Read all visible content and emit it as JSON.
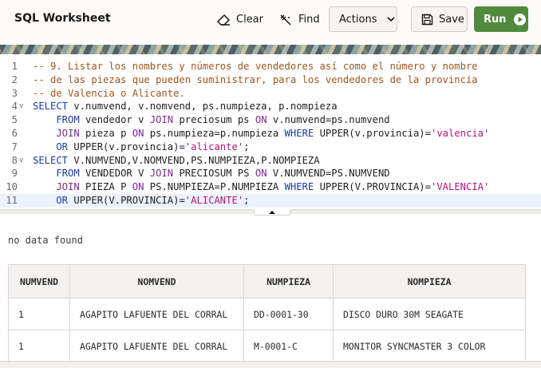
{
  "header": {
    "title": "SQL Worksheet",
    "clear_label": "Clear",
    "find_label": "Find",
    "actions_label": "Actions",
    "save_label": "Save",
    "run_label": "Run",
    "run_color": "#508a3c"
  },
  "editor": {
    "lines": [
      {
        "n": "1",
        "fold": "",
        "tokens": [
          {
            "t": "-- 9. Listar los nombres y números de vendedores así como el número y nombre",
            "c": "com"
          }
        ]
      },
      {
        "n": "2",
        "fold": "",
        "tokens": [
          {
            "t": "-- de las piezas que pueden suministrar, para los vendedores de la provincia",
            "c": "com"
          }
        ]
      },
      {
        "n": "3",
        "fold": "",
        "tokens": [
          {
            "t": "-- de Valencia o Alicante.",
            "c": "com"
          }
        ]
      },
      {
        "n": "4",
        "fold": "v",
        "tokens": [
          {
            "t": "SELECT",
            "c": "kw"
          },
          {
            "t": " v.numvend, v.nomvend, ps.numpieza, p.nompieza",
            "c": ""
          }
        ]
      },
      {
        "n": "5",
        "fold": "",
        "tokens": [
          {
            "t": "    FROM",
            "c": "kw"
          },
          {
            "t": " vendedor v ",
            "c": ""
          },
          {
            "t": "JOIN",
            "c": "kw2"
          },
          {
            "t": " preciosum ps ",
            "c": ""
          },
          {
            "t": "ON",
            "c": "kw2"
          },
          {
            "t": " v.numvend=ps.numvend",
            "c": ""
          }
        ]
      },
      {
        "n": "6",
        "fold": "",
        "tokens": [
          {
            "t": "    JOIN",
            "c": "kw2"
          },
          {
            "t": " pieza p ",
            "c": ""
          },
          {
            "t": "ON",
            "c": "kw2"
          },
          {
            "t": " ps.numpieza=p.numpieza ",
            "c": ""
          },
          {
            "t": "WHERE",
            "c": "kw"
          },
          {
            "t": " UPPER(v.provincia)=",
            "c": ""
          },
          {
            "t": "'valencia'",
            "c": "str"
          }
        ]
      },
      {
        "n": "7",
        "fold": "",
        "tokens": [
          {
            "t": "    OR",
            "c": "kw"
          },
          {
            "t": " UPPER(v.provincia)=",
            "c": ""
          },
          {
            "t": "'alicante'",
            "c": "str"
          },
          {
            "t": ";",
            "c": ""
          }
        ]
      },
      {
        "n": "8",
        "fold": "v",
        "tokens": [
          {
            "t": "SELECT",
            "c": "kw"
          },
          {
            "t": " V.NUMVEND,V.NOMVEND,PS.NUMPIEZA,P.NOMPIEZA",
            "c": ""
          }
        ]
      },
      {
        "n": "9",
        "fold": "",
        "tokens": [
          {
            "t": "    FROM",
            "c": "kw"
          },
          {
            "t": " VENDEDOR V ",
            "c": ""
          },
          {
            "t": "JOIN",
            "c": "kw2"
          },
          {
            "t": " PRECIOSUM PS ",
            "c": ""
          },
          {
            "t": "ON",
            "c": "kw2"
          },
          {
            "t": " V.NUMVEND=PS.NUMVEND",
            "c": ""
          }
        ]
      },
      {
        "n": "10",
        "fold": "",
        "tokens": [
          {
            "t": "    JOIN",
            "c": "kw2"
          },
          {
            "t": " PIEZA P ",
            "c": ""
          },
          {
            "t": "ON",
            "c": "kw2"
          },
          {
            "t": " PS.NUMPIEZA=P.NUMPIEZA ",
            "c": ""
          },
          {
            "t": "WHERE",
            "c": "kw"
          },
          {
            "t": " UPPER(V.PROVINCIA)=",
            "c": ""
          },
          {
            "t": "'VALENCIA'",
            "c": "str"
          }
        ]
      },
      {
        "n": "11",
        "fold": "",
        "active": true,
        "tokens": [
          {
            "t": "    OR",
            "c": "kw"
          },
          {
            "t": " UPPER(V.PROVINCIA)=",
            "c": ""
          },
          {
            "t": "'ALICANTE'",
            "c": "str"
          },
          {
            "t": ";",
            "c": ""
          }
        ]
      }
    ]
  },
  "results": {
    "status": "no data found",
    "columns": [
      "NUMVEND",
      "NOMVEND",
      "NUMPIEZA",
      "NOMPIEZA"
    ],
    "rows": [
      [
        "1",
        "AGAPITO LAFUENTE DEL CORRAL",
        "DD-0001-30",
        "DISCO DURO 30M SEAGATE"
      ],
      [
        "1",
        "AGAPITO LAFUENTE DEL CORRAL",
        "M-0001-C",
        "MONITOR SYNCMASTER 3 COLOR"
      ]
    ]
  }
}
